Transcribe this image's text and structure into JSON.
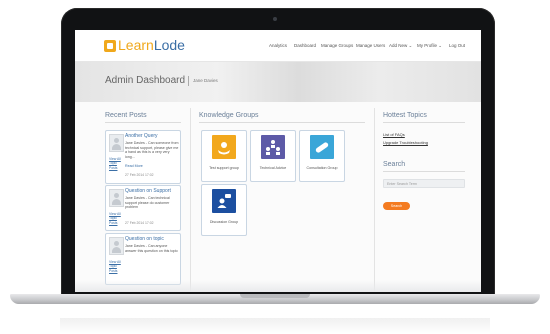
{
  "app": {
    "logo_part1": "Learn",
    "logo_part2": "Lode"
  },
  "nav": {
    "items": [
      "Analytics",
      "Dashboard",
      "Manage Groups",
      "Manage Users",
      "Add New",
      "My Profile",
      "Log Out"
    ],
    "add_new_caret": "⌄",
    "profile_caret": "⌄"
  },
  "header": {
    "title": "Admin Dashboard",
    "user": "Jane Davies"
  },
  "recent_posts": {
    "title": "Recent Posts",
    "items": [
      {
        "title": "Another Query",
        "body": "Jane Davies - Can someone from technical support, please give me a hand as this is a very very long...",
        "more": "Read More",
        "date": "27 Feb 2014 17:02",
        "view_link": "View All Topic Posts"
      },
      {
        "title": "Question on Support",
        "body": "Jane Davies - Can technical support please do customer problem",
        "more": "",
        "date": "27 Feb 2014 17:02",
        "view_link": "View All Topic Posts"
      },
      {
        "title": "Question on topic",
        "body": "Jane Davies - Can anyone answer this question on this topic",
        "more": "",
        "date": "",
        "view_link": "View All Topic Posts"
      }
    ]
  },
  "knowledge_groups": {
    "title": "Knowledge Groups",
    "items": [
      {
        "label": "Test support group",
        "color": "#f2a81d",
        "icon": "hand-heart-icon"
      },
      {
        "label": "Technical Advice",
        "color": "#5d5aa7",
        "icon": "people-hierarchy-icon"
      },
      {
        "label": "Consultation Group",
        "color": "#3aa6d8",
        "icon": "pill-icon"
      },
      {
        "label": "Discussion Group",
        "color": "#1c4fa0",
        "icon": "chat-person-icon"
      }
    ]
  },
  "hottest_topics": {
    "title": "Hottest Topics",
    "items": [
      "List of FAQs",
      "Upgrade Troubleshooting"
    ]
  },
  "search": {
    "title": "Search",
    "placeholder": "Enter Search Term",
    "button_label": "Search"
  },
  "colors": {
    "accent_orange": "#f47b20",
    "brand_yellow": "#f0a81c",
    "brand_blue": "#3a6ea5",
    "link_blue": "#3b6fa6"
  }
}
